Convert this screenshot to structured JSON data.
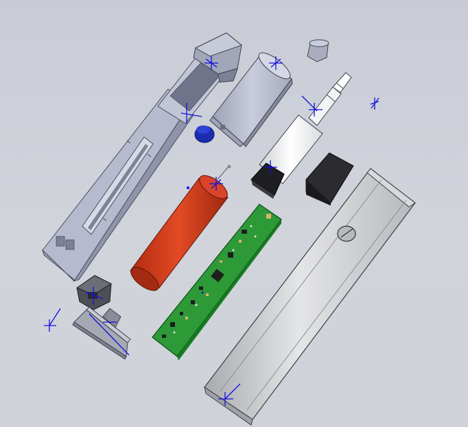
{
  "viewport": {
    "view": "exploded-assembly",
    "background_color": "#cdd0d8",
    "triad_color": "#1010e0"
  },
  "parts": [
    {
      "id": "chassis-frame",
      "icon": "frame-icon",
      "color": "#aab0c6"
    },
    {
      "id": "emitter-cone",
      "icon": "cone-icon",
      "color": "#9a9fb2"
    },
    {
      "id": "speaker-housing",
      "icon": "cylinder-icon",
      "color": "#b5b9cc"
    },
    {
      "id": "end-cap-small",
      "icon": "cap-icon",
      "color": "#a7abbc"
    },
    {
      "id": "motor-shaft",
      "icon": "shaft-icon",
      "color": "#ffffff"
    },
    {
      "id": "black-block",
      "icon": "block-icon",
      "color": "#2a2a2e"
    },
    {
      "id": "blue-button",
      "icon": "button-icon",
      "color": "#1a2db0"
    },
    {
      "id": "battery-cell",
      "icon": "battery-icon",
      "color": "#d2381a"
    },
    {
      "id": "pcb-board",
      "icon": "pcb-icon",
      "color": "#1f8c2a"
    },
    {
      "id": "outer-tube",
      "icon": "tube-icon",
      "color": "#c3c5c8"
    },
    {
      "id": "usb-connector",
      "icon": "connector-icon",
      "color": "#4d4f57"
    },
    {
      "id": "bottom-plate",
      "icon": "plate-icon",
      "color": "#a6a9b3"
    }
  ]
}
